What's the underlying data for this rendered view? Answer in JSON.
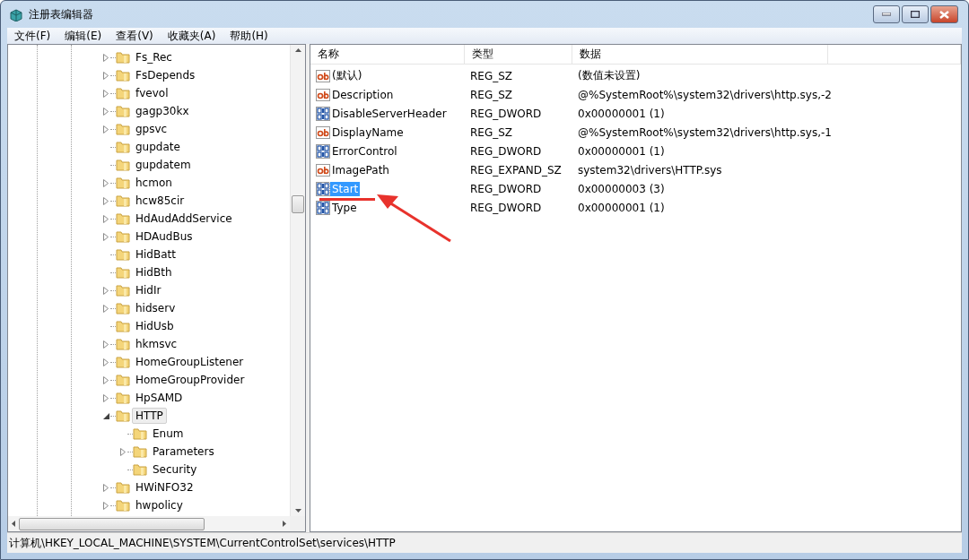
{
  "window": {
    "title": "注册表编辑器"
  },
  "menu": [
    "文件(F)",
    "编辑(E)",
    "查看(V)",
    "收藏夹(A)",
    "帮助(H)"
  ],
  "tree": [
    {
      "label": "Fs_Rec",
      "has_children": true,
      "expanded": false,
      "selected": false
    },
    {
      "label": "FsDepends",
      "has_children": true,
      "expanded": false,
      "selected": false
    },
    {
      "label": "fvevol",
      "has_children": true,
      "expanded": false,
      "selected": false
    },
    {
      "label": "gagp30kx",
      "has_children": true,
      "expanded": false,
      "selected": false
    },
    {
      "label": "gpsvc",
      "has_children": true,
      "expanded": false,
      "selected": false
    },
    {
      "label": "gupdate",
      "has_children": false,
      "selected": false
    },
    {
      "label": "gupdatem",
      "has_children": false,
      "selected": false
    },
    {
      "label": "hcmon",
      "has_children": true,
      "expanded": false,
      "selected": false
    },
    {
      "label": "hcw85cir",
      "has_children": true,
      "expanded": false,
      "selected": false
    },
    {
      "label": "HdAudAddService",
      "has_children": true,
      "expanded": false,
      "selected": false
    },
    {
      "label": "HDAudBus",
      "has_children": true,
      "expanded": false,
      "selected": false
    },
    {
      "label": "HidBatt",
      "has_children": false,
      "selected": false
    },
    {
      "label": "HidBth",
      "has_children": false,
      "selected": false
    },
    {
      "label": "HidIr",
      "has_children": true,
      "expanded": false,
      "selected": false
    },
    {
      "label": "hidserv",
      "has_children": true,
      "expanded": false,
      "selected": false
    },
    {
      "label": "HidUsb",
      "has_children": false,
      "selected": false
    },
    {
      "label": "hkmsvc",
      "has_children": true,
      "expanded": false,
      "selected": false
    },
    {
      "label": "HomeGroupListener",
      "has_children": true,
      "expanded": false,
      "selected": false
    },
    {
      "label": "HomeGroupProvider",
      "has_children": true,
      "expanded": false,
      "selected": false
    },
    {
      "label": "HpSAMD",
      "has_children": true,
      "expanded": false,
      "selected": false
    },
    {
      "label": "HTTP",
      "has_children": true,
      "expanded": true,
      "selected": true,
      "children": [
        {
          "label": "Enum",
          "has_children": false,
          "selected": false
        },
        {
          "label": "Parameters",
          "has_children": true,
          "expanded": false,
          "selected": false
        },
        {
          "label": "Security",
          "has_children": false,
          "selected": false
        }
      ]
    },
    {
      "label": "HWiNFO32",
      "has_children": true,
      "expanded": false,
      "selected": false
    },
    {
      "label": "hwpolicy",
      "has_children": true,
      "expanded": false,
      "selected": false
    }
  ],
  "table": {
    "columns": [
      "名称",
      "类型",
      "数据"
    ],
    "rows": [
      {
        "kind": "string",
        "name": "(默认)",
        "type": "REG_SZ",
        "data": "(数值未设置)",
        "selected": false
      },
      {
        "kind": "string",
        "name": "Description",
        "type": "REG_SZ",
        "data": "@%SystemRoot%\\system32\\drivers\\http.sys,-2",
        "selected": false
      },
      {
        "kind": "binary",
        "name": "DisableServerHeader",
        "type": "REG_DWORD",
        "data": "0x00000001 (1)",
        "selected": false
      },
      {
        "kind": "string",
        "name": "DisplayName",
        "type": "REG_SZ",
        "data": "@%SystemRoot%\\system32\\drivers\\http.sys,-1",
        "selected": false
      },
      {
        "kind": "binary",
        "name": "ErrorControl",
        "type": "REG_DWORD",
        "data": "0x00000001 (1)",
        "selected": false
      },
      {
        "kind": "string",
        "name": "ImagePath",
        "type": "REG_EXPAND_SZ",
        "data": "system32\\drivers\\HTTP.sys",
        "selected": false
      },
      {
        "kind": "binary",
        "name": "Start",
        "type": "REG_DWORD",
        "data": "0x00000003 (3)",
        "selected": true
      },
      {
        "kind": "binary",
        "name": "Type",
        "type": "REG_DWORD",
        "data": "0x00000001 (1)",
        "selected": false
      }
    ]
  },
  "status_bar": "计算机\\HKEY_LOCAL_MACHINE\\SYSTEM\\CurrentControlSet\\services\\HTTP"
}
